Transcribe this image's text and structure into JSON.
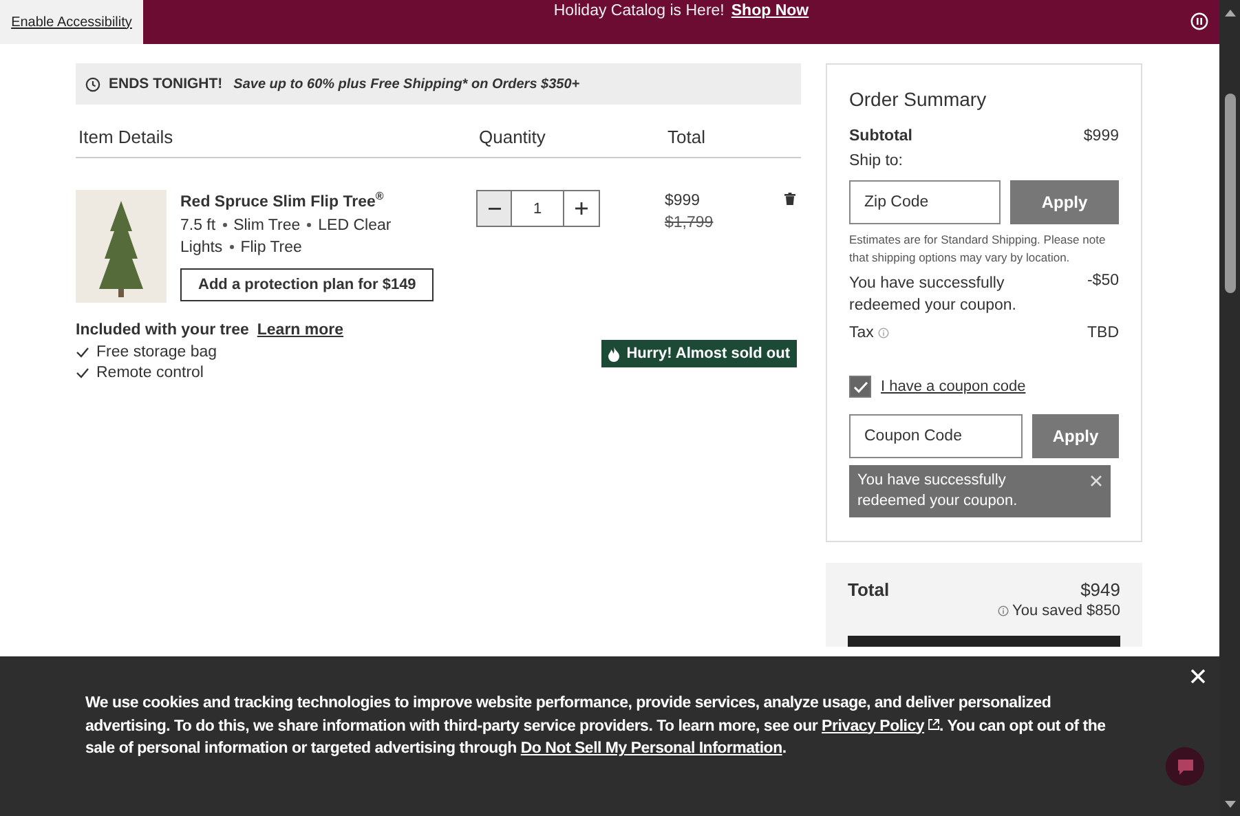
{
  "accessibility_button": "Enable Accessibility",
  "promo_banner": {
    "text": "Holiday Catalog is Here!",
    "link": "Shop Now"
  },
  "sale_notice": {
    "headline": "ENDS TONIGHT!",
    "text": "Save up to 60% plus Free Shipping* on Orders $350+"
  },
  "cart": {
    "columns": [
      "Item Details",
      "Quantity",
      "Total"
    ],
    "item": {
      "name": "Red Spruce Slim Flip Tree$^{®}$",
      "attributes": [
        "7.5 ft",
        "Slim Tree",
        "LED Clear Lights",
        "Flip Tree"
      ],
      "protection_button": "Add a protection plan for $149",
      "quantity": "1",
      "price": "$999",
      "original_price": "$1,799",
      "stock_badge": "Hurry! Almost sold out"
    },
    "included": {
      "title": "Included with your tree",
      "link": "Learn more",
      "items": [
        "Free storage bag",
        "Remote control"
      ]
    }
  },
  "summary": {
    "title": "Order Summary",
    "subtotal_label": "Subtotal",
    "subtotal_value": "$999",
    "ship_to_label": "Ship to:",
    "zip_placeholder": "Zip Code",
    "zip_apply": "Apply",
    "shipping_note": "Estimates are for Standard Shipping. Please note that shipping options may vary by location.",
    "discount_label": "You have successfully redeemed your coupon.",
    "discount_value": "-$50",
    "tax_label": "Tax",
    "tax_value": "TBD",
    "coupon_checkbox": {
      "label": "I have a coupon code",
      "checked": true
    },
    "coupon_placeholder": "Coupon Code",
    "coupon_apply": "Apply",
    "coupon_message": "You have successfully redeemed your coupon.",
    "total_label": "Total",
    "total_value": "$949",
    "saved": "You saved $850"
  },
  "cookie_banner": {
    "text_1": "We use cookies and tracking technologies to improve website performance, provide services, analyze usage, and deliver personalized advertising. To do this, we share information with third-party service providers. To learn more, see our ",
    "link_1": "Privacy Policy",
    "text_2": ". You can opt out of the sale of personal information or targeted advertising through ",
    "link_2": "Do Not Sell My Personal Information",
    "text_3": "."
  }
}
